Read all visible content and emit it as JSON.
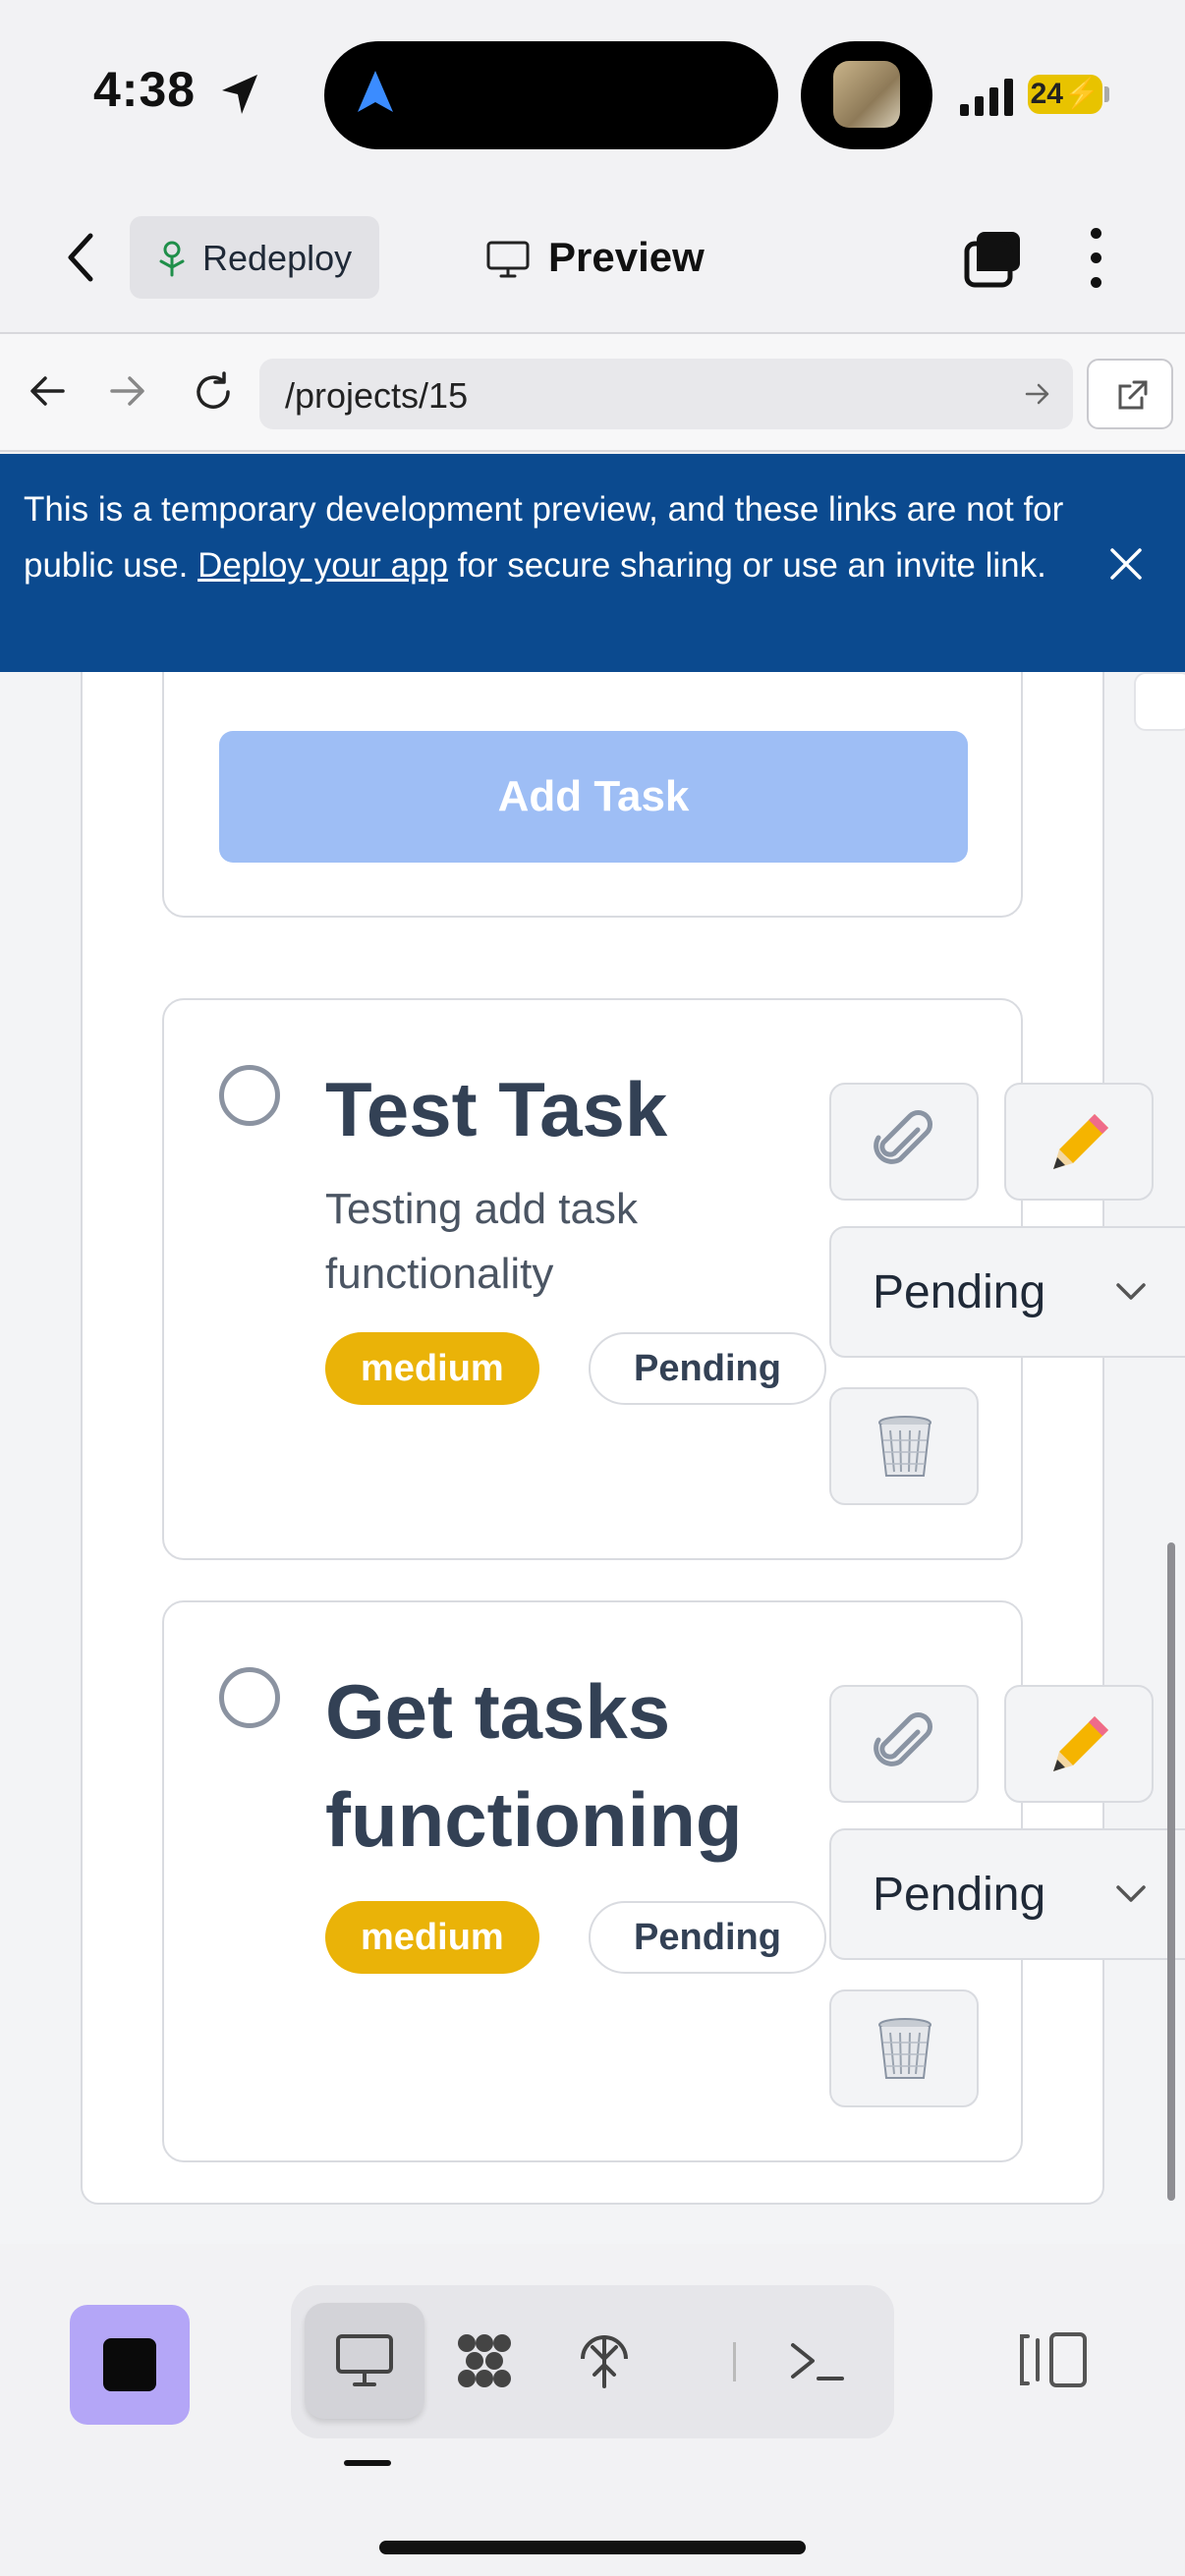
{
  "status_bar": {
    "time": "4:38",
    "battery": "24"
  },
  "header": {
    "redeploy_label": "Redeploy",
    "preview_label": "Preview"
  },
  "url_bar": {
    "path": "/projects/15"
  },
  "banner": {
    "text_before": "This is a temporary development preview, and these links are not for public use. ",
    "link_text": "Deploy your app",
    "text_after": " for secure sharing or use an invite link."
  },
  "form": {
    "add_task_label": "Add Task"
  },
  "tasks": [
    {
      "title": "Test Task",
      "description": "Testing add task functionality",
      "priority": "medium",
      "status_badge": "Pending",
      "status_select": "Pending"
    },
    {
      "title": "Get tasks functioning",
      "description": "",
      "priority": "medium",
      "status_badge": "Pending",
      "status_select": "Pending"
    }
  ],
  "colors": {
    "banner": "#0b4a8f",
    "priority_medium": "#eab308",
    "add_task_button": "#9ebef5",
    "stop_button": "#b4a6f7"
  }
}
